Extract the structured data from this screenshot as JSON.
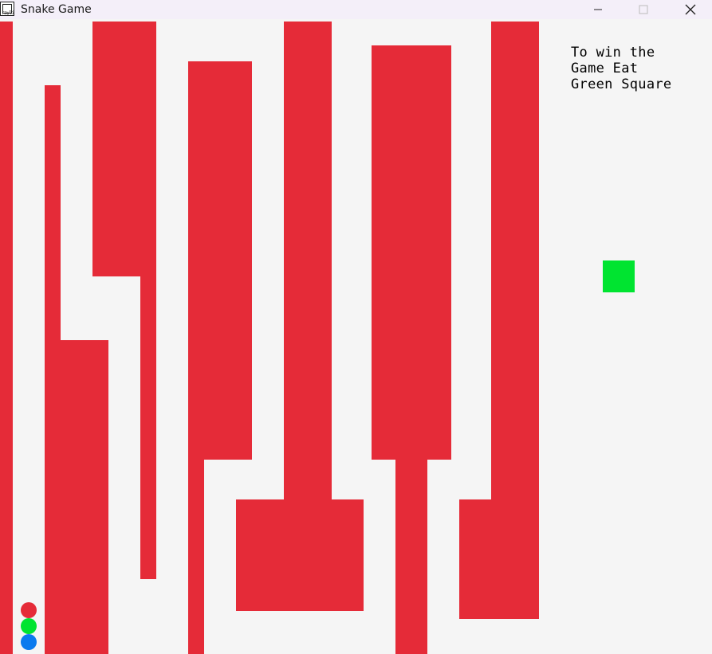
{
  "window": {
    "title": "Snake Game",
    "app_icon_text": "raylib",
    "app_icon": "raylib-app-icon",
    "controls": [
      "minimize-icon",
      "maximize-icon",
      "close-icon"
    ]
  },
  "game": {
    "hint_text": "To win the\nGame Eat\nGreen Square",
    "colors": {
      "background": "#f5f5f5",
      "wall": "#e52b38",
      "goal": "#00e430",
      "snake_head": "#e52b38",
      "snake_body": "#00e430",
      "snake_tail": "#0a7aee"
    },
    "snake_segments": [
      "head",
      "body",
      "tail"
    ]
  }
}
